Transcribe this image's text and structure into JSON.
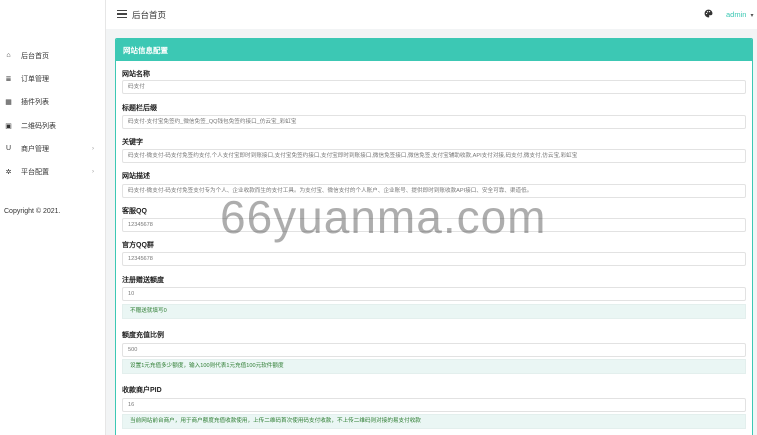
{
  "header": {
    "title": "后台首页",
    "user": "admin",
    "user_caret": "▾"
  },
  "sidebar": {
    "items": [
      {
        "label": "后台首页",
        "icon": "home-icon",
        "glyph": "⌂",
        "caret": ""
      },
      {
        "label": "订单管理",
        "icon": "list-icon",
        "glyph": "≣",
        "caret": ""
      },
      {
        "label": "插件列表",
        "icon": "plugin-icon",
        "glyph": "▦",
        "caret": ""
      },
      {
        "label": "二维码列表",
        "icon": "qrcode-icon",
        "glyph": "▣",
        "caret": ""
      },
      {
        "label": "商户管理",
        "icon": "merchant-icon",
        "glyph": "U",
        "caret": "›"
      },
      {
        "label": "平台配置",
        "icon": "gear-icon",
        "glyph": "✲",
        "caret": "›"
      }
    ],
    "copyright": "Copyright © 2021."
  },
  "panel": {
    "title": "网站信息配置",
    "fields": [
      {
        "label": "网站名称",
        "value": "码支付"
      },
      {
        "label": "标题栏后缀",
        "value": "码支付-支付宝免签约_微信免签_QQ钱包免签约接口_仿云宝_彩虹宝"
      },
      {
        "label": "关键字",
        "value": "码支付-微支付-码支付免签约支付,个人支付宝即时到账接口,支付宝免签约接口,支付宝即时到账接口,微信免签接口,微信免签,支付宝辅助收款,API支付对接,码支付,微支付,仿云宝,彩虹宝"
      },
      {
        "label": "网站描述",
        "value": "码支付-微支付-码支付免签支付专为个人、企业收款而生的支付工具。为支付宝、微信支付的个人账户、企业账号、提供即时到账收款API接口、安全可靠、渠道低。"
      },
      {
        "label": "客服QQ",
        "value": "12345678"
      },
      {
        "label": "官方QQ群",
        "value": "12345678"
      },
      {
        "label": "注册赠送额度",
        "value": "10",
        "hint": "不赠送就填写0"
      },
      {
        "label": "额度充值比例",
        "value": "500",
        "hint": "设置1元充值多少额度，输入100则代表1元充值100元软件额度"
      },
      {
        "label": "收款商户PID",
        "value": "16",
        "hint": "当前网站前台商户，用于商户额度充值收款使用，上传二维码首次使用码支付收款，不上传二维码则对接的易支付收款"
      }
    ]
  },
  "watermark": "66yuanma.com"
}
